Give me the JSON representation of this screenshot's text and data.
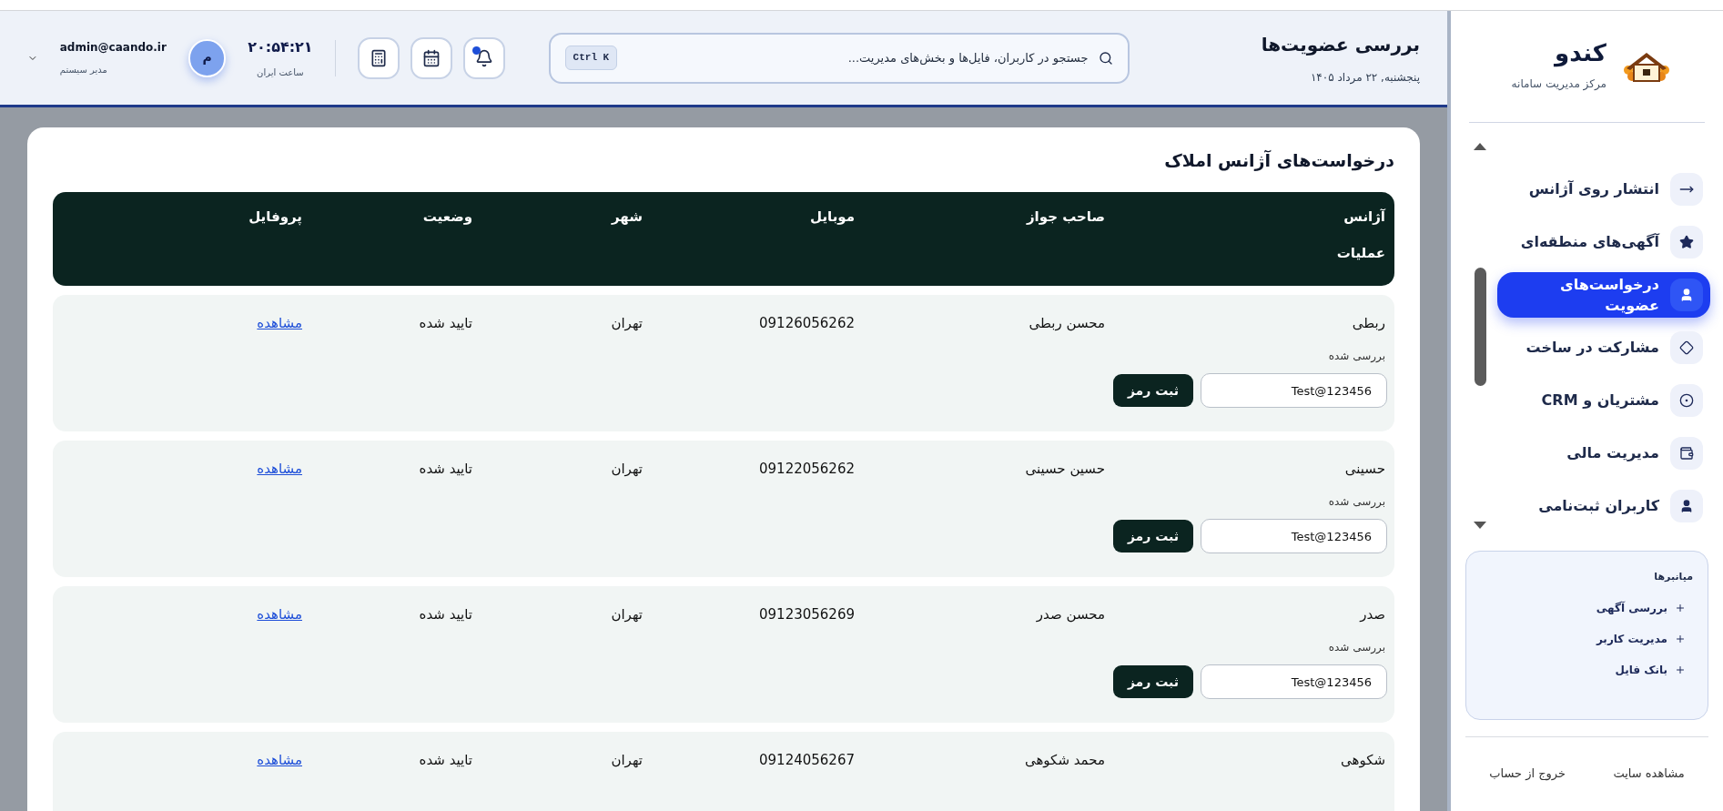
{
  "header": {
    "title": "بررسی عضویت‌ها",
    "date": "پنجشنبه, ۲۲ مرداد ۱۴۰۵",
    "search": {
      "placeholder": "جستجو در کاربران، فایل‌ها و بخش‌های مدیریت...",
      "shortcut": "Ctrl K"
    },
    "notifications": {
      "unread": true
    },
    "clock": {
      "time": "۲۰:۵۴:۲۱",
      "label": "ساعت ایران"
    },
    "user": {
      "avatar_initial": "م",
      "email": "admin@caando.ir",
      "role": "مدیر سیستم"
    }
  },
  "card": {
    "title": "درخواست‌های آژانس املاک",
    "columns": [
      "آژانس",
      "صاحب جواز",
      "موبایل",
      "شهر",
      "وضعیت",
      "پروفایل"
    ],
    "actions_column": "عملیات",
    "rows": [
      {
        "agency": "ربطی",
        "owner": "محسن ربطی",
        "mobile": "09126056262",
        "city": "تهران",
        "status": "تایید شده",
        "profile": "مشاهده",
        "review": "بررسی شده",
        "password": "Test@123456",
        "save": "ثبت رمز"
      },
      {
        "agency": "حسینی",
        "owner": "حسین حسینی",
        "mobile": "09122056262",
        "city": "تهران",
        "status": "تایید شده",
        "profile": "مشاهده",
        "review": "بررسی شده",
        "password": "Test@123456",
        "save": "ثبت رمز"
      },
      {
        "agency": "صدر",
        "owner": "محسن صدر",
        "mobile": "09123056269",
        "city": "تهران",
        "status": "تایید شده",
        "profile": "مشاهده",
        "review": "بررسی شده",
        "password": "Test@123456",
        "save": "ثبت رمز"
      },
      {
        "agency": "شکوهی",
        "owner": "محمد شکوهی",
        "mobile": "09124056267",
        "city": "تهران",
        "status": "تایید شده",
        "profile": "مشاهده"
      }
    ]
  },
  "sidebar": {
    "brand": "کندو",
    "subtitle": "مرکز مدیریت سامانه",
    "nav": [
      {
        "label": "انتشار روی آژانس",
        "kind": "arrow",
        "selected": false
      },
      {
        "label": "آگهی‌های منطقه‌ای",
        "kind": "star",
        "selected": false
      },
      {
        "label": "درخواست‌های عضویت",
        "kind": "person",
        "selected": true
      },
      {
        "label": "مشارکت در ساخت",
        "kind": "diamond",
        "selected": false
      },
      {
        "label": "مشتریان و CRM",
        "kind": "target",
        "selected": false
      },
      {
        "label": "مدیریت مالی",
        "kind": "wallet",
        "selected": false
      },
      {
        "label": "کاربران ثبت‌نامی",
        "kind": "person",
        "selected": false
      }
    ],
    "shortcuts": {
      "title": "میانبرها",
      "items": [
        "بررسی آگهی",
        "مدیریت کاربر",
        "بانک فایل"
      ]
    },
    "footer_links": [
      "مشاهده سایت",
      "خروج از حساب"
    ]
  }
}
